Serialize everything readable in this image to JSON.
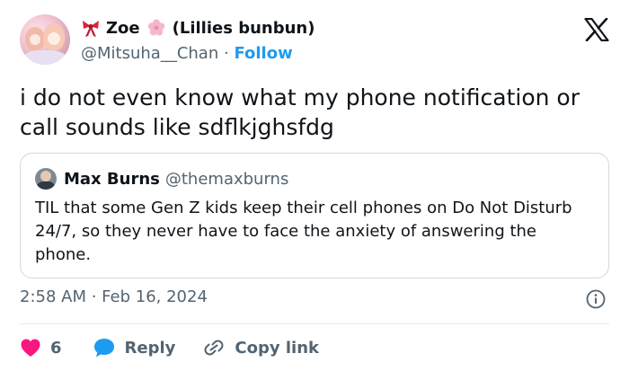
{
  "author": {
    "name": "Zoe",
    "name_suffix": "(Lillies bunbun)",
    "handle": "@Mitsuha__Chan",
    "separator": "·",
    "follow_label": "Follow"
  },
  "tweet": {
    "text": "i do not even know what my phone notification or call sounds like sdflkjghsfdg"
  },
  "quoted_tweet": {
    "name": "Max Burns",
    "handle": "@themaxburns",
    "text": "TIL that some Gen Z kids keep their cell phones on Do Not Disturb 24/7, so they never have to face the anxiety of answering the phone."
  },
  "meta": {
    "timestamp": "2:58 AM · Feb 16, 2024"
  },
  "actions": {
    "like_count": "6",
    "reply_label": "Reply",
    "copy_link_label": "Copy link"
  },
  "colors": {
    "accent": "#1d9bf0",
    "like": "#f91880",
    "muted": "#536471",
    "text": "#0f1419",
    "border": "#cfd9de"
  },
  "icons": [
    "x-logo-icon",
    "ribbon-icon",
    "blossom-icon",
    "info-icon",
    "heart-icon",
    "reply-bubble-icon",
    "link-icon"
  ]
}
